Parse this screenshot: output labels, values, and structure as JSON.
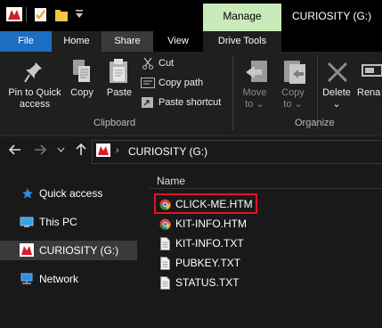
{
  "window": {
    "title": "CURIOSITY (G:)",
    "context_tab": "Manage"
  },
  "tabs": [
    "File",
    "Home",
    "Share",
    "View",
    "Drive Tools"
  ],
  "ribbon": {
    "clipboard": {
      "pin_label_1": "Pin to Quick",
      "pin_label_2": "access",
      "copy": "Copy",
      "paste": "Paste",
      "cut": "Cut",
      "copy_path": "Copy path",
      "paste_shortcut": "Paste shortcut",
      "group": "Clipboard"
    },
    "organize": {
      "move_to_1": "Move",
      "move_to_2": "to",
      "copy_to_1": "Copy",
      "copy_to_2": "to",
      "delete": "Delete",
      "rename": "Rena",
      "group": "Organize"
    }
  },
  "address": {
    "path": "CURIOSITY (G:)"
  },
  "nav": [
    {
      "label": "Quick access",
      "icon": "star-icon"
    },
    {
      "label": "This PC",
      "icon": "computer-icon"
    },
    {
      "label": "CURIOSITY (G:)",
      "icon": "drive-icon",
      "selected": true
    },
    {
      "label": "Network",
      "icon": "network-icon"
    }
  ],
  "files": {
    "header": "Name",
    "items": [
      {
        "name": "CLICK-ME.HTM",
        "icon": "chrome-icon",
        "highlighted": true
      },
      {
        "name": "KIT-INFO.HTM",
        "icon": "chrome-icon"
      },
      {
        "name": "KIT-INFO.TXT",
        "icon": "text-file-icon"
      },
      {
        "name": "PUBKEY.TXT",
        "icon": "text-file-icon"
      },
      {
        "name": "STATUS.TXT",
        "icon": "text-file-icon"
      }
    ]
  },
  "colors": {
    "file_tab": "#1b6ec2",
    "manage_tab": "#c8ebb9",
    "highlight_box": "#e81123",
    "selected_nav": "#3a3a3a"
  }
}
